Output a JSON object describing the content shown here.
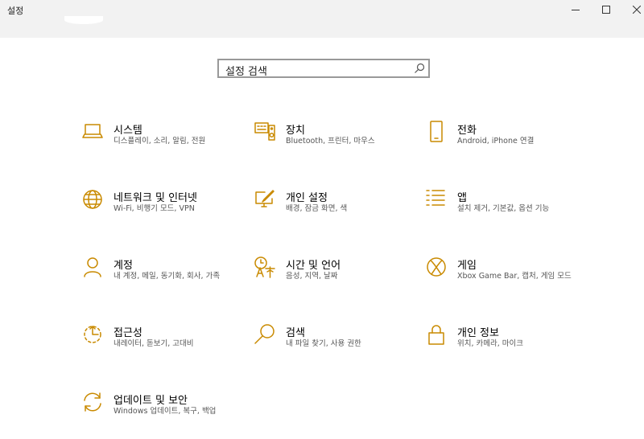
{
  "window": {
    "title": "설정"
  },
  "search": {
    "placeholder": "설정 검색"
  },
  "tiles": [
    {
      "name": "시스템",
      "desc": "디스플레이, 소리, 알림, 전원",
      "icon": "laptop-icon"
    },
    {
      "name": "장치",
      "desc": "Bluetooth, 프린터, 마우스",
      "icon": "keyboard-speaker-icon"
    },
    {
      "name": "전화",
      "desc": "Android, iPhone 연결",
      "icon": "phone-icon"
    },
    {
      "name": "네트워크 및 인터넷",
      "desc": "Wi-Fi, 비행기 모드, VPN",
      "icon": "globe-icon"
    },
    {
      "name": "개인 설정",
      "desc": "배경, 잠금 화면, 색",
      "icon": "paint-monitor-icon"
    },
    {
      "name": "앱",
      "desc": "설치 제거, 기본값, 옵션 기능",
      "icon": "apps-list-icon"
    },
    {
      "name": "계정",
      "desc": "내 계정, 메일, 동기화, 회사, 가족",
      "icon": "person-icon"
    },
    {
      "name": "시간 및 언어",
      "desc": "음성, 지역, 날짜",
      "icon": "time-language-icon"
    },
    {
      "name": "게임",
      "desc": "Xbox Game Bar, 캡처, 게임 모드",
      "icon": "xbox-icon"
    },
    {
      "name": "접근성",
      "desc": "내레이터, 돋보기, 고대비",
      "icon": "ease-of-access-icon"
    },
    {
      "name": "검색",
      "desc": "내 파일 찾기, 사용 권한",
      "icon": "search-magnifier-icon"
    },
    {
      "name": "개인 정보",
      "desc": "위치, 카메라, 마이크",
      "icon": "lock-icon"
    },
    {
      "name": "업데이트 및 보안",
      "desc": "Windows 업데이트, 복구, 백업",
      "icon": "sync-arrows-icon"
    }
  ],
  "colors": {
    "accent": "#c98a00",
    "titlebar": "#f2f2f2"
  }
}
